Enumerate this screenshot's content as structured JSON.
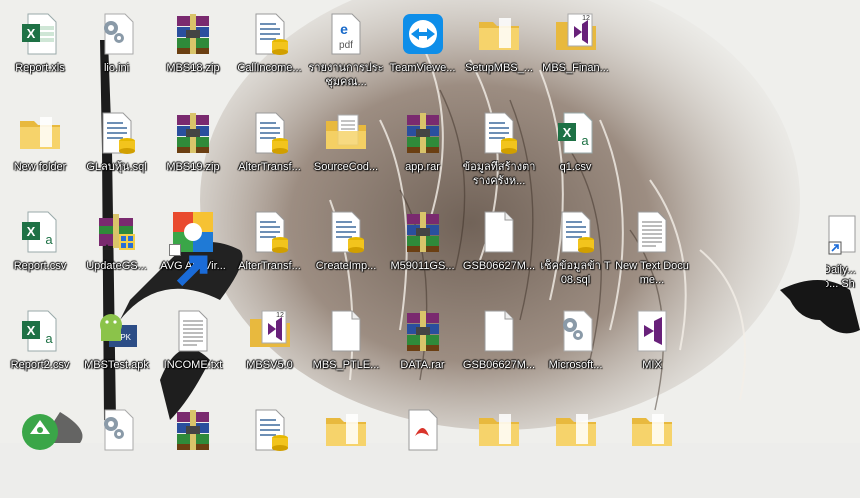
{
  "desktop": {
    "icons": [
      {
        "col": 0,
        "row": 0,
        "type": "excel",
        "label": "Report.xls"
      },
      {
        "col": 1,
        "row": 0,
        "type": "config",
        "label": "lio.ini"
      },
      {
        "col": 2,
        "row": 0,
        "type": "winrar",
        "label": "MBS18.zip"
      },
      {
        "col": 3,
        "row": 0,
        "type": "sqlfile",
        "label": "CallIncome..."
      },
      {
        "col": 4,
        "row": 0,
        "type": "pdf",
        "label": "รายงานการประชุมคณ..."
      },
      {
        "col": 5,
        "row": 0,
        "type": "teamviewer",
        "label": "TeamViewe..."
      },
      {
        "col": 6,
        "row": 0,
        "type": "folder",
        "label": "SetupMBS_..."
      },
      {
        "col": 7,
        "row": 0,
        "type": "vs",
        "label": "MBS_Finan..."
      },
      {
        "col": 0,
        "row": 1,
        "type": "folder",
        "label": "New folder"
      },
      {
        "col": 1,
        "row": 1,
        "type": "sqlfile",
        "label": "GLลบหุ้น.sql"
      },
      {
        "col": 2,
        "row": 1,
        "type": "winrar",
        "label": "MBS19.zip"
      },
      {
        "col": 3,
        "row": 1,
        "type": "sqlfile",
        "label": "AlterTransf..."
      },
      {
        "col": 4,
        "row": 1,
        "type": "folderdoc",
        "label": "SourceCod..."
      },
      {
        "col": 5,
        "row": 1,
        "type": "winrar",
        "label": "app.rar"
      },
      {
        "col": 6,
        "row": 1,
        "type": "sqlfile",
        "label": "ข้อมูลที่สร้างตารางครังห..."
      },
      {
        "col": 7,
        "row": 1,
        "type": "csv",
        "label": "q1.csv"
      },
      {
        "col": 0,
        "row": 2,
        "type": "csv",
        "label": "Report.csv"
      },
      {
        "col": 1,
        "row": 2,
        "type": "installer",
        "label": "UpdateGS..."
      },
      {
        "col": 2,
        "row": 2,
        "type": "avg",
        "label": "AVG AntiVir...",
        "shortcut": true
      },
      {
        "col": 3,
        "row": 2,
        "type": "sqlfile",
        "label": "AlterTransf..."
      },
      {
        "col": 4,
        "row": 2,
        "type": "sqlfile",
        "label": "CreateImp..."
      },
      {
        "col": 5,
        "row": 2,
        "type": "winrar",
        "label": "M59011GS..."
      },
      {
        "col": 6,
        "row": 2,
        "type": "blank",
        "label": "GSB06627M..."
      },
      {
        "col": 7,
        "row": 2,
        "type": "sqlfile",
        "label": "เช็คข้อมูลข้า T08.sql"
      },
      {
        "col": 8,
        "row": 2,
        "type": "textdoc",
        "label": "New Text Docume..."
      },
      {
        "col": 0,
        "row": 3,
        "type": "csv",
        "label": "Report2.csv"
      },
      {
        "col": 1,
        "row": 3,
        "type": "apk",
        "label": "MBSTest.apk"
      },
      {
        "col": 2,
        "row": 3,
        "type": "textdoc",
        "label": "INCOME.txt"
      },
      {
        "col": 3,
        "row": 3,
        "type": "vs",
        "label": "MBSV5.0"
      },
      {
        "col": 4,
        "row": 3,
        "type": "blank",
        "label": "MBS_PTLE..."
      },
      {
        "col": 5,
        "row": 3,
        "type": "winrar",
        "label": "DATA.rar"
      },
      {
        "col": 6,
        "row": 3,
        "type": "blank",
        "label": "GSB06627M..."
      },
      {
        "col": 7,
        "row": 3,
        "type": "config",
        "label": "Microsoft..."
      },
      {
        "col": 8,
        "row": 3,
        "type": "vsflat",
        "label": "MIX"
      },
      {
        "col": 0,
        "row": 4,
        "type": "android",
        "label": ""
      },
      {
        "col": 1,
        "row": 4,
        "type": "config",
        "label": ""
      },
      {
        "col": 2,
        "row": 4,
        "type": "winrar",
        "label": ""
      },
      {
        "col": 3,
        "row": 4,
        "type": "sqlfile",
        "label": ""
      },
      {
        "col": 4,
        "row": 4,
        "type": "folder",
        "label": ""
      },
      {
        "col": 5,
        "row": 4,
        "type": "pdfred",
        "label": ""
      },
      {
        "col": 6,
        "row": 4,
        "type": "folder",
        "label": ""
      },
      {
        "col": 7,
        "row": 4,
        "type": "folder",
        "label": ""
      },
      {
        "col": 8,
        "row": 4,
        "type": "folder",
        "label": ""
      }
    ],
    "edge_item": {
      "type": "shortcut-doc",
      "label": "Daily... o... Sho..."
    }
  }
}
